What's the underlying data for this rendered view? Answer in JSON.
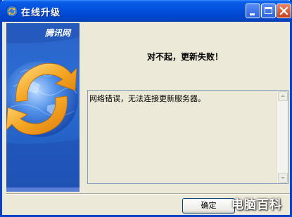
{
  "window": {
    "title": "在线升级"
  },
  "banner": {
    "brand": "腾讯网"
  },
  "message": {
    "heading": "对不起，更新失败！",
    "detail": "网络错误，无法连接更新服务器。"
  },
  "buttons": {
    "ok_label": "确定"
  },
  "watermark": {
    "text": "电脑百科"
  },
  "colors": {
    "titlebar": "#0352de",
    "window_bg": "#ece9d8",
    "banner_blue": "#2b6fd6",
    "arrow_orange": "#f5a623"
  },
  "icons": [
    "app-update-icon",
    "minimize-icon",
    "maximize-icon",
    "close-icon",
    "globe-arrows-icon",
    "scroll-up-icon",
    "scroll-down-icon"
  ]
}
